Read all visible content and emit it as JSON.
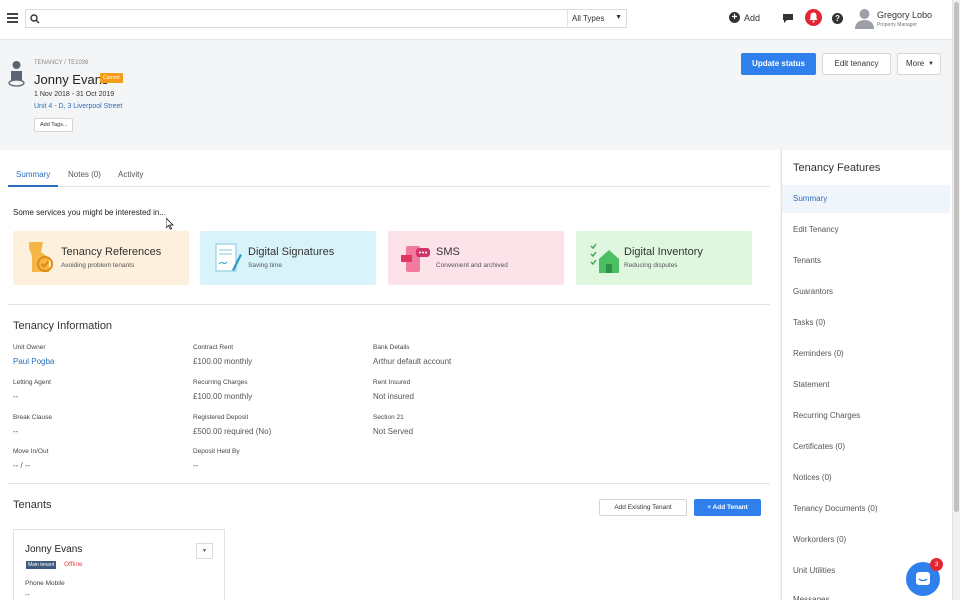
{
  "topbar": {
    "search_placeholder": "",
    "type_filter": "All Types",
    "add_label": "Add",
    "user_name": "Gregory Lobo",
    "user_role": "Property Manager",
    "notification_color": "#e32636"
  },
  "header": {
    "breadcrumb": "TENANCY / TE1036",
    "tenant_name": "Jonny Evans",
    "status_badge": "Current",
    "dates": "1 Nov 2018 - 31 Oct 2019",
    "unit_link": "Unit 4 - D, 3 Liverpool Street",
    "add_tags_label": "Add Tags...",
    "update_status_label": "Update status",
    "edit_tenancy_label": "Edit tenancy",
    "more_label": "More"
  },
  "tabs": [
    {
      "label": "Summary",
      "active": true
    },
    {
      "label": "Notes (0)",
      "active": false
    },
    {
      "label": "Activity",
      "active": false
    }
  ],
  "services": {
    "intro": "Some services you might be interested in...",
    "cards": [
      {
        "title": "Tenancy References",
        "subtitle": "Avoiding problem tenants",
        "bg": "#fdf0dc",
        "icon": "tenancy-references-icon"
      },
      {
        "title": "Digital Signatures",
        "subtitle": "Saving time",
        "bg": "#d9f3fb",
        "icon": "digital-signatures-icon"
      },
      {
        "title": "SMS",
        "subtitle": "Convenient and archived",
        "bg": "#fce3ea",
        "icon": "sms-icon"
      },
      {
        "title": "Digital Inventory",
        "subtitle": "Reducing disputes",
        "bg": "#dff7df",
        "icon": "digital-inventory-icon"
      }
    ]
  },
  "tenancy_info": {
    "title": "Tenancy Information",
    "fields": [
      {
        "label": "Unit Owner",
        "value": "Paul Pogba",
        "link": true
      },
      {
        "label": "Letting Agent",
        "value": "--"
      },
      {
        "label": "Break Clause",
        "value": "--"
      },
      {
        "label": "Move In/Out",
        "value": "-- / --"
      },
      {
        "label": "Contract Rent",
        "value": "£100.00 monthly"
      },
      {
        "label": "Recurring Charges",
        "value": "£100.00 monthly"
      },
      {
        "label": "Registered Deposit",
        "value": "£500.00 required (No)"
      },
      {
        "label": "Deposit Held By",
        "value": "--"
      },
      {
        "label": "Bank Details",
        "value": "Arthur default account"
      },
      {
        "label": "Rent Insured",
        "value": "Not insured"
      },
      {
        "label": "Section 21",
        "value": "Not Served"
      }
    ]
  },
  "tenants": {
    "title": "Tenants",
    "add_existing_label": "Add Existing Tenant",
    "add_tenant_label": "+ Add Tenant",
    "cards": [
      {
        "name": "Jonny Evans",
        "badge": "Main tenant",
        "status": "Offline",
        "phone_label": "Phone Mobile",
        "phone_value": "--"
      }
    ]
  },
  "sidebar": {
    "title": "Tenancy Features",
    "items": [
      {
        "label": "Summary",
        "active": true
      },
      {
        "label": "Edit Tenancy"
      },
      {
        "label": "Tenants"
      },
      {
        "label": "Guarantors"
      },
      {
        "label": "Tasks (0)"
      },
      {
        "label": "Reminders (0)"
      },
      {
        "label": "Statement"
      },
      {
        "label": "Recurring Charges"
      },
      {
        "label": "Certificates (0)"
      },
      {
        "label": "Notices (0)"
      },
      {
        "label": "Tenancy Documents (0)"
      },
      {
        "label": "Workorders (0)"
      },
      {
        "label": "Unit Utilities"
      },
      {
        "label": "Messages"
      }
    ]
  },
  "chat": {
    "unread_count": "3"
  },
  "colors": {
    "accent": "#2f80ed",
    "badge_current": "#f59c1a",
    "offline": "#e04848"
  }
}
